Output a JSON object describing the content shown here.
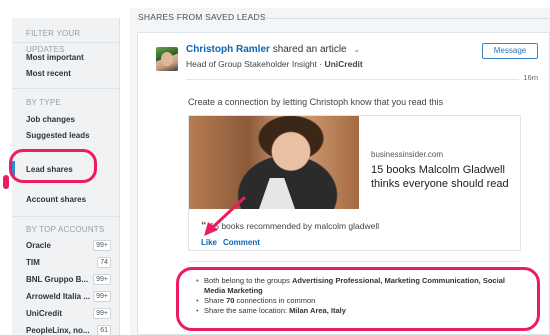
{
  "sidebar": {
    "filter_heading": "FILTER YOUR UPDATES",
    "filter_items": [
      "Most important",
      "Most recent"
    ],
    "type_heading": "BY TYPE",
    "type_items": [
      "Job changes",
      "Suggested leads",
      "Lead shares",
      "Account shares"
    ],
    "accounts_heading": "BY TOP ACCOUNTS",
    "accounts": [
      {
        "name": "Oracle",
        "count": "99+"
      },
      {
        "name": "TIM",
        "count": "74"
      },
      {
        "name": "BNL Gruppo B...",
        "count": "99+"
      },
      {
        "name": "Arroweld Italia ...",
        "count": "99+"
      },
      {
        "name": "UniCredit",
        "count": "99+"
      },
      {
        "name": "PeopleLinx, no...",
        "count": "61"
      }
    ]
  },
  "main": {
    "section_title": "SHARES FROM SAVED LEADS",
    "post": {
      "author": "Christoph Ramler",
      "action": "shared an article",
      "headline_prefix": "Head of Group Stakeholder Insight · ",
      "company": "UniCredit",
      "message_button": "Message",
      "time": "16m",
      "prompt": "Create a connection by letting Christoph know that you read this",
      "article": {
        "source": "businessinsider.com",
        "title": "15 books Malcolm Gladwell thinks everyone should read"
      },
      "recommended": "15 books recommended by malcolm gladwell",
      "like_label": "Like",
      "comment_label": "Comment"
    },
    "insights": [
      {
        "prefix": "Both belong to the groups ",
        "bold": "Advertising Professional, Marketing Communication, Social Media Marketing",
        "suffix": ""
      },
      {
        "prefix": "Share ",
        "bold": "70",
        "suffix": " connections in common"
      },
      {
        "prefix": "Share the same location: ",
        "bold": "Milan Area, Italy",
        "suffix": ""
      }
    ]
  },
  "colors": {
    "link": "#0a66b7",
    "annotation": "#ec1d5c",
    "active_bar": "#2a8fd6"
  }
}
